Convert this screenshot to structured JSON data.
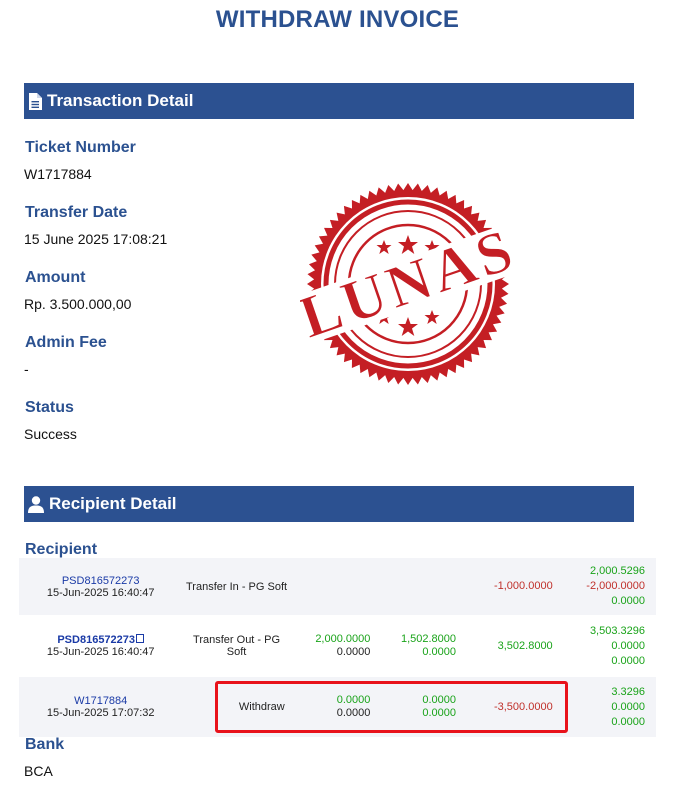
{
  "page": {
    "title": "WITHDRAW INVOICE"
  },
  "transaction_section": {
    "header": "Transaction Detail",
    "fields": [
      {
        "label": "Ticket Number",
        "value": "W1717884"
      },
      {
        "label": "Transfer Date",
        "value": "15 June 2025 17:08:21"
      },
      {
        "label": "Amount",
        "value": "Rp. 3.500.000,00"
      },
      {
        "label": "Admin Fee",
        "value": "-"
      },
      {
        "label": "Status",
        "value": "Success"
      }
    ]
  },
  "stamp": {
    "text": "LUNAS",
    "color": "#c41e24"
  },
  "recipient_section": {
    "header": "Recipient Detail",
    "recipient_label": "Recipient",
    "bank_label": "Bank",
    "bank_value": "BCA"
  },
  "transactions": [
    {
      "ref": "PSD816572273",
      "time": "15-Jun-2025 16:40:47",
      "desc": "Transfer In - PG Soft",
      "col1a": "",
      "col1b": "",
      "col2a": "",
      "col2b": "",
      "amount": "-1,000.0000",
      "bal1": "2,000.5296",
      "bal2": "-2,000.0000",
      "bal3": "0.0000"
    },
    {
      "ref": "PSD816572273",
      "time": "15-Jun-2025 16:40:47",
      "desc": "Transfer Out - PG Soft",
      "col1a": "2,000.0000",
      "col1b": "0.0000",
      "col2a": "1,502.8000",
      "col2b": "0.0000",
      "amount": "3,502.8000",
      "bal1": "3,503.3296",
      "bal2": "0.0000",
      "bal3": "0.0000"
    },
    {
      "ref": "W1717884",
      "time": "15-Jun-2025 17:07:32",
      "desc": "Withdraw",
      "col1a": "0.0000",
      "col1b": "0.0000",
      "col2a": "0.0000",
      "col2b": "0.0000",
      "amount": "-3,500.0000",
      "bal1": "3.3296",
      "bal2": "0.0000",
      "bal3": "0.0000"
    }
  ],
  "colors": {
    "brand_blue": "#2c5191",
    "positive": "#1aa31a",
    "negative": "#c0302b",
    "highlight": "#e8121b"
  }
}
